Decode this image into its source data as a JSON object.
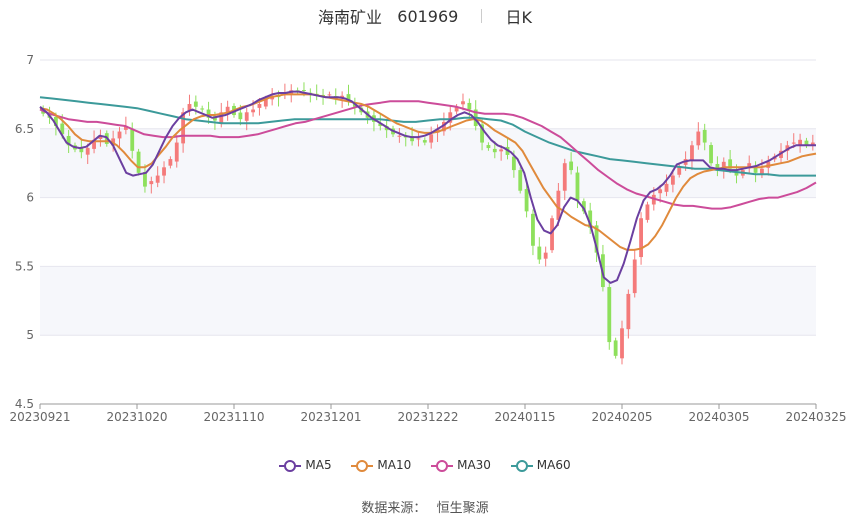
{
  "header": {
    "name": "海南矿业",
    "code": "601969",
    "period": "日K"
  },
  "source": {
    "label": "数据来源：",
    "value": "恒生聚源"
  },
  "colors": {
    "up": "#f47a7a",
    "down": "#8ee05c",
    "MA5": "#6b3fa0",
    "MA10": "#e08a3c",
    "MA30": "#cc4c9a",
    "MA60": "#3c9a9a",
    "grid": "#e6e6ee"
  },
  "chart_data": {
    "type": "candlestick",
    "ylim": [
      4.5,
      7
    ],
    "yticks": [
      "4.5",
      "5",
      "5.5",
      "6",
      "6.5",
      "7"
    ],
    "xticks": [
      "20230921",
      "20231020",
      "20231110",
      "20231201",
      "20231222",
      "20240115",
      "20240205",
      "20240305",
      "20240325"
    ],
    "legend": [
      "MA5",
      "MA10",
      "MA30",
      "MA60"
    ],
    "closes": [
      6.61,
      6.58,
      6.52,
      6.46,
      6.38,
      6.35,
      6.33,
      6.36,
      6.42,
      6.45,
      6.39,
      6.43,
      6.48,
      6.52,
      6.34,
      6.18,
      6.08,
      6.12,
      6.16,
      6.22,
      6.28,
      6.4,
      6.62,
      6.68,
      6.66,
      6.64,
      6.58,
      6.56,
      6.62,
      6.66,
      6.6,
      6.57,
      6.62,
      6.64,
      6.68,
      6.72,
      6.74,
      6.73,
      6.76,
      6.78,
      6.77,
      6.78,
      6.76,
      6.74,
      6.73,
      6.75,
      6.72,
      6.74,
      6.7,
      6.66,
      6.62,
      6.58,
      6.55,
      6.52,
      6.49,
      6.46,
      6.45,
      6.44,
      6.41,
      6.43,
      6.4,
      6.46,
      6.5,
      6.55,
      6.62,
      6.66,
      6.7,
      6.64,
      6.52,
      6.4,
      6.36,
      6.33,
      6.35,
      6.31,
      6.2,
      6.05,
      5.9,
      5.65,
      5.55,
      5.6,
      5.85,
      6.05,
      6.25,
      6.2,
      5.98,
      5.9,
      5.78,
      5.6,
      5.35,
      4.95,
      4.85,
      5.05,
      5.3,
      5.55,
      5.85,
      5.95,
      6.02,
      6.06,
      6.1,
      6.16,
      6.22,
      6.28,
      6.38,
      6.48,
      6.4,
      6.25,
      6.2,
      6.26,
      6.21,
      6.16,
      6.2,
      6.25,
      6.18,
      6.21,
      6.26,
      6.3,
      6.34,
      6.38,
      6.4,
      6.42,
      6.38,
      6.4
    ],
    "ma5": [
      6.66,
      6.62,
      6.56,
      6.48,
      6.4,
      6.37,
      6.36,
      6.37,
      6.41,
      6.45,
      6.44,
      6.38,
      6.28,
      6.18,
      6.16,
      6.17,
      6.18,
      6.24,
      6.34,
      6.44,
      6.52,
      6.58,
      6.62,
      6.64,
      6.62,
      6.6,
      6.58,
      6.59,
      6.6,
      6.62,
      6.64,
      6.66,
      6.68,
      6.71,
      6.73,
      6.75,
      6.76,
      6.76,
      6.77,
      6.77,
      6.76,
      6.75,
      6.74,
      6.73,
      6.73,
      6.73,
      6.72,
      6.7,
      6.66,
      6.62,
      6.58,
      6.55,
      6.52,
      6.49,
      6.47,
      6.45,
      6.44,
      6.44,
      6.45,
      6.47,
      6.5,
      6.53,
      6.57,
      6.6,
      6.62,
      6.6,
      6.55,
      6.48,
      6.42,
      6.38,
      6.36,
      6.33,
      6.28,
      6.18,
      6.0,
      5.84,
      5.76,
      5.74,
      5.8,
      5.93,
      6.0,
      5.98,
      5.92,
      5.8,
      5.62,
      5.42,
      5.38,
      5.4,
      5.52,
      5.68,
      5.85,
      5.98,
      6.04,
      6.06,
      6.1,
      6.16,
      6.24,
      6.26,
      6.27,
      6.27,
      6.27,
      6.22,
      6.21,
      6.21,
      6.2,
      6.2,
      6.21,
      6.22,
      6.23,
      6.25,
      6.27,
      6.3,
      6.33,
      6.36,
      6.38,
      6.38,
      6.38,
      6.38
    ],
    "ma10": [
      6.65,
      6.64,
      6.61,
      6.57,
      6.52,
      6.46,
      6.42,
      6.41,
      6.41,
      6.41,
      6.41,
      6.38,
      6.33,
      6.27,
      6.22,
      6.22,
      6.25,
      6.31,
      6.37,
      6.44,
      6.49,
      6.53,
      6.57,
      6.59,
      6.6,
      6.6,
      6.61,
      6.62,
      6.64,
      6.66,
      6.67,
      6.69,
      6.71,
      6.73,
      6.74,
      6.75,
      6.75,
      6.75,
      6.75,
      6.75,
      6.74,
      6.73,
      6.72,
      6.71,
      6.7,
      6.69,
      6.68,
      6.66,
      6.63,
      6.6,
      6.57,
      6.54,
      6.52,
      6.5,
      6.48,
      6.47,
      6.47,
      6.48,
      6.5,
      6.52,
      6.54,
      6.56,
      6.57,
      6.56,
      6.53,
      6.49,
      6.46,
      6.43,
      6.4,
      6.34,
      6.25,
      6.16,
      6.07,
      6.0,
      5.93,
      5.9,
      5.86,
      5.83,
      5.8,
      5.79,
      5.76,
      5.72,
      5.68,
      5.64,
      5.62,
      5.62,
      5.63,
      5.66,
      5.72,
      5.8,
      5.9,
      6.0,
      6.08,
      6.14,
      6.17,
      6.19,
      6.2,
      6.21,
      6.22,
      6.22,
      6.22,
      6.22,
      6.22,
      6.22,
      6.23,
      6.24,
      6.25,
      6.26,
      6.28,
      6.3,
      6.31,
      6.32
    ],
    "ma30": [
      6.64,
      6.61,
      6.59,
      6.57,
      6.56,
      6.55,
      6.55,
      6.54,
      6.53,
      6.52,
      6.49,
      6.46,
      6.45,
      6.44,
      6.44,
      6.45,
      6.45,
      6.45,
      6.45,
      6.44,
      6.44,
      6.44,
      6.45,
      6.46,
      6.48,
      6.5,
      6.52,
      6.54,
      6.55,
      6.57,
      6.59,
      6.61,
      6.63,
      6.65,
      6.67,
      6.68,
      6.69,
      6.7,
      6.7,
      6.7,
      6.7,
      6.69,
      6.68,
      6.67,
      6.66,
      6.64,
      6.62,
      6.61,
      6.61,
      6.61,
      6.6,
      6.58,
      6.55,
      6.52,
      6.48,
      6.44,
      6.38,
      6.32,
      6.26,
      6.2,
      6.15,
      6.1,
      6.06,
      6.03,
      6.01,
      5.99,
      5.97,
      5.95,
      5.94,
      5.94,
      5.93,
      5.92,
      5.92,
      5.93,
      5.95,
      5.97,
      5.99,
      6.0,
      6.0,
      6.02,
      6.04,
      6.07,
      6.11
    ],
    "ma60": [
      6.73,
      6.72,
      6.71,
      6.7,
      6.69,
      6.68,
      6.67,
      6.66,
      6.65,
      6.63,
      6.61,
      6.59,
      6.57,
      6.56,
      6.55,
      6.54,
      6.54,
      6.54,
      6.54,
      6.55,
      6.56,
      6.57,
      6.57,
      6.57,
      6.57,
      6.57,
      6.57,
      6.57,
      6.57,
      6.56,
      6.55,
      6.55,
      6.56,
      6.57,
      6.57,
      6.58,
      6.58,
      6.57,
      6.56,
      6.53,
      6.48,
      6.44,
      6.4,
      6.37,
      6.34,
      6.32,
      6.3,
      6.28,
      6.27,
      6.26,
      6.25,
      6.24,
      6.23,
      6.22,
      6.21,
      6.21,
      6.2,
      6.19,
      6.18,
      6.17,
      6.17,
      6.16,
      6.16,
      6.16,
      6.16
    ]
  }
}
